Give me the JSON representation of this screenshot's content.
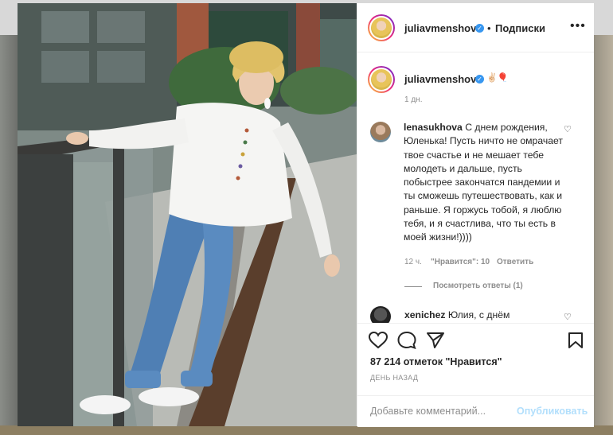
{
  "header": {
    "username": "juliavmenshova",
    "separator": "•",
    "follow_label": "Подписки",
    "more_icon": "more-horizontal-icon"
  },
  "caption": {
    "username": "juliavmenshova",
    "emoji": "✌🏻🎈",
    "time": "1 дн."
  },
  "comment1": {
    "username": "lenasukhova",
    "text": "С днем рождения, Юленька! Пусть ничто не омрачает твое счастье и не мешает тебе молодеть и дальше, пусть побыстрее закончатся пандемии и ты сможешь путешествовать, как и раньше. Я горжусь тобой, я люблю тебя, и я счастлива, что ты есть в моей жизни!))))",
    "time": "12 ч.",
    "likes": "\"Нравится\": 10",
    "reply_label": "Ответить",
    "view_replies": "Посмотреть ответы (1)"
  },
  "comment2": {
    "username": "xenichez",
    "text": "Юлия, с днём"
  },
  "actions": {
    "likes": "87 214 отметок \"Нравится\"",
    "post_time": "ДЕНЬ НАЗАД",
    "comment_placeholder": "Добавьте комментарий...",
    "publish_label": "Опубликовать"
  },
  "colors": {
    "accent": "#3897f0",
    "publish_disabled": "#b2dffc",
    "secondary_text": "#8e8e8e"
  }
}
